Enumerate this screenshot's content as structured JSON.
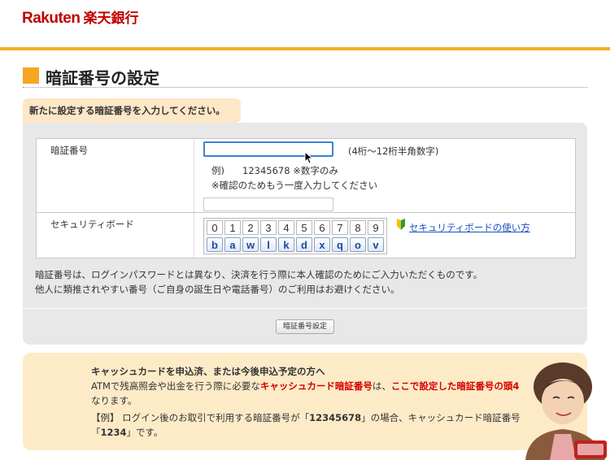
{
  "brand": {
    "logo_en": "Rakuten",
    "logo_jp": "楽天銀行",
    "color": "#bf0000"
  },
  "page": {
    "title": "暗証番号の設定"
  },
  "instruction": "新たに設定する暗証番号を入力してください。",
  "form": {
    "pin": {
      "label": "暗証番号",
      "value": "",
      "constraint": "(4桁〜12桁半角数字)",
      "example_label": "例)",
      "example_value": "12345678 ※数字のみ",
      "confirm_hint": "※確認のためもう一度入力してください",
      "confirm_value": ""
    },
    "security_board": {
      "label": "セキュリティボード",
      "digits": [
        "0",
        "1",
        "2",
        "3",
        "4",
        "5",
        "6",
        "7",
        "8",
        "9"
      ],
      "letters": [
        "b",
        "a",
        "w",
        "l",
        "k",
        "d",
        "x",
        "q",
        "o",
        "v"
      ],
      "help_link": "セキュリティボードの使い方"
    }
  },
  "notes": [
    "暗証番号は、ログインパスワードとは異なり、決済を行う際に本人確認のためにご入力いただくものです。",
    "他人に類推されやすい番号（ご自身の誕生日や電話番号）のご利用はお避けください。"
  ],
  "submit_label": "暗証番号設定",
  "info": {
    "heading": "キャッシュカードを申込済、または今後申込予定の方へ",
    "line2_a": "ATMで残高照会や出金を行う際に必要な",
    "line2_red1": "キャッシュカード暗証番号",
    "line2_b": "は、",
    "line2_red2": "ここで設定した暗証番号の頭4",
    "line3": "なります。",
    "line4_a": "【例】 ログイン後のお取引で利用する暗証番号が「",
    "line4_bold": "12345678",
    "line4_b": "」の場合、キャッシュカード暗証番号",
    "line5_a": "「",
    "line5_bold": "1234",
    "line5_b": "」です。"
  },
  "colors": {
    "accent": "#f5b01f",
    "title_square": "#f5a623",
    "link": "#1a4fbf",
    "alert_red": "#d40000"
  }
}
